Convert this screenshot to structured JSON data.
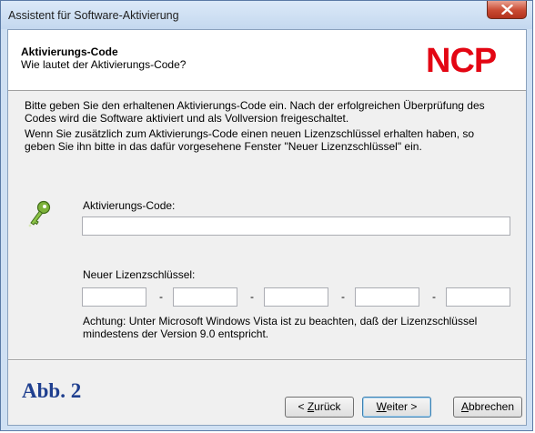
{
  "window": {
    "title": "Assistent für Software-Aktivierung"
  },
  "header": {
    "title": "Aktivierungs-Code",
    "subtitle": "Wie lautet der Aktivierungs-Code?",
    "logo_text": "NCP"
  },
  "instructions": {
    "line1": "Bitte geben Sie den erhaltenen Aktivierungs-Code ein. Nach der erfolgreichen Überprüfung des",
    "line2": "Codes wird die Software aktiviert und als Vollversion freigeschaltet.",
    "line3": "Wenn Sie zusätzlich zum Aktivierungs-Code einen neuen Lizenzschlüssel erhalten haben, so",
    "line4": "geben Sie ihn bitte in das dafür vorgesehene Fenster \"Neuer Lizenzschlüssel\" ein."
  },
  "activation": {
    "label": "Aktivierungs-Code:",
    "value": ""
  },
  "license": {
    "label": "Neuer Lizenzschlüssel:",
    "separator": "-",
    "fields": [
      "",
      "",
      "",
      "",
      ""
    ]
  },
  "note": {
    "line1": "Achtung: Unter Microsoft Windows Vista ist zu beachten, daß der Lizenzschlüssel",
    "line2": "mindestens der Version 9.0 entspricht."
  },
  "caption": "Abb. 2",
  "buttons": {
    "back": {
      "prefix": "< ",
      "mnemonic": "Z",
      "rest": "urück"
    },
    "next": {
      "mnemonic": "W",
      "rest": "eiter",
      "suffix": " >"
    },
    "cancel": {
      "mnemonic": "A",
      "rest": "bbrechen"
    }
  },
  "colors": {
    "logo_red": "#e30613",
    "caption_blue": "#1f3f8f",
    "close_red": "#c94a32"
  }
}
